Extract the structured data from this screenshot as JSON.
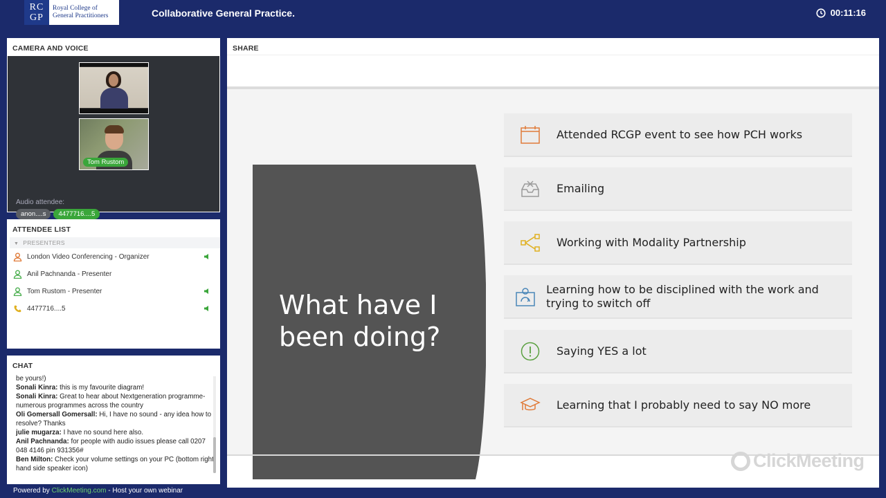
{
  "header": {
    "logo_letters_top": "RC",
    "logo_letters_bottom": "GP",
    "logo_line1": "Royal College of",
    "logo_line2": "General Practitioners",
    "title": "Collaborative General Practice.",
    "timer": "00:11:16"
  },
  "camera": {
    "title": "CAMERA AND VOICE",
    "video2_name": "Tom Rustom",
    "audio_label": "Audio attendee:",
    "chips": [
      "anon....s",
      "4477716....5"
    ]
  },
  "attendees": {
    "title": "ATTENDEE LIST",
    "group": "PRESENTERS",
    "rows": [
      {
        "name": "London Video Conferencing  - Organizer",
        "icon": "organizer-icon",
        "speaker": true
      },
      {
        "name": "Anil Pachnanda  - Presenter",
        "icon": "presenter-icon",
        "speaker": false
      },
      {
        "name": "Tom Rustom  - Presenter",
        "icon": "presenter-icon",
        "speaker": true
      },
      {
        "name": "4477716....5",
        "icon": "phone-icon",
        "speaker": true
      }
    ]
  },
  "chat": {
    "title": "CHAT",
    "messages": [
      {
        "author": "",
        "text": "be yours!)"
      },
      {
        "author": "Sonali  Kinra:",
        "text": " this is my favourite diagram!"
      },
      {
        "author": "Sonali  Kinra:",
        "text": " Great to hear about Nextgeneration programme- numerous programmes across the country"
      },
      {
        "author": "Oli Gomersall Gomersall:",
        "text": " Hi, I have no sound - any idea how to resolve? Thanks"
      },
      {
        "author": "julie mugarza:",
        "text": " I have no sound here also."
      },
      {
        "author": "Anil Pachnanda:",
        "text": " for people with audio issues please call 0207 048 4146   pin 931356#"
      },
      {
        "author": "Ben Milton:",
        "text": " Check your volume settings on your PC (bottom right hand side speaker icon)"
      }
    ]
  },
  "footer": {
    "prefix": "Powered by ",
    "link": "ClickMeeting.com",
    "suffix": " - Host your own webinar"
  },
  "share": {
    "title": "SHARE",
    "slide_heading": "What have I been doing?",
    "items": [
      {
        "label": "Attended RCGP event to see how PCH works",
        "icon": "calendar-icon",
        "color": "#e07b39"
      },
      {
        "label": "Emailing",
        "icon": "inbox-icon",
        "color": "#9a9a9a"
      },
      {
        "label": "Working with Modality Partnership",
        "icon": "network-icon",
        "color": "#e0b020"
      },
      {
        "label": "Learning how to be disciplined with the work and trying to switch off",
        "icon": "user-sync-icon",
        "color": "#4a86b8"
      },
      {
        "label": "Saying YES a lot",
        "icon": "alert-icon",
        "color": "#5aa040"
      },
      {
        "label": "Learning that I probably need to say NO more",
        "icon": "graduation-cap-icon",
        "color": "#e07b39"
      }
    ],
    "watermark": "ClickMeeting"
  }
}
